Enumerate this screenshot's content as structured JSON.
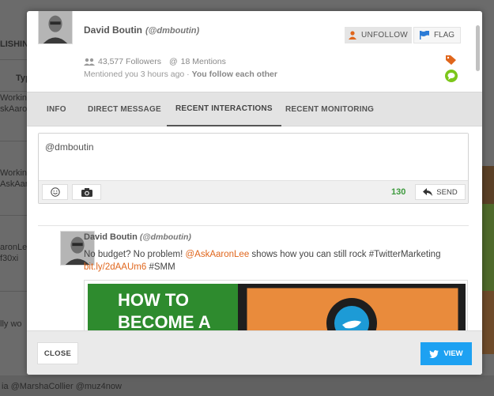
{
  "background": {
    "left_fragments": [
      "LISHIN",
      "Typ",
      "Working",
      "skAaro",
      "Working",
      "AskAaro",
      "aronLee",
      "f30xi",
      "lly wo"
    ],
    "bottom_text": "ia @MarshaCollier @muz4now"
  },
  "profile": {
    "name": "David Boutin",
    "handle": "(@dmboutin)",
    "followers": "43,577 Followers",
    "mentions": "18 Mentions",
    "mentioned_time": "Mentioned you 3 hours ago",
    "separator": " · ",
    "relationship": "You follow each other",
    "unfollow_label": "UNFOLLOW",
    "flag_label": "FLAG"
  },
  "tabs": [
    {
      "label": "INFO"
    },
    {
      "label": "DIRECT MESSAGE"
    },
    {
      "label": "RECENT INTERACTIONS"
    },
    {
      "label": "RECENT MONITORING"
    }
  ],
  "active_tab": "RECENT INTERACTIONS",
  "composer": {
    "value": "@dmboutin",
    "char_count": "130",
    "send_label": "SEND"
  },
  "tweet": {
    "name": "David Boutin",
    "handle": "(@dmboutin)",
    "text_before": "No budget? No problem! ",
    "mention": "@AskAaronLee",
    "text_after": " shows how you can still rock #TwitterMarketing",
    "link": "bit.ly/2dAAUm6",
    "hashtag": " #SMM",
    "image_text_line1": "HOW TO",
    "image_text_line2": "BECOME A"
  },
  "footer": {
    "close_label": "CLOSE",
    "view_label": "VIEW"
  },
  "colors": {
    "accent_orange": "#e0661c",
    "twitter_blue": "#1da1f2",
    "count_green": "#3d9a3d",
    "flag_blue": "#2b7bd6",
    "chat_green": "#7cc61a"
  }
}
